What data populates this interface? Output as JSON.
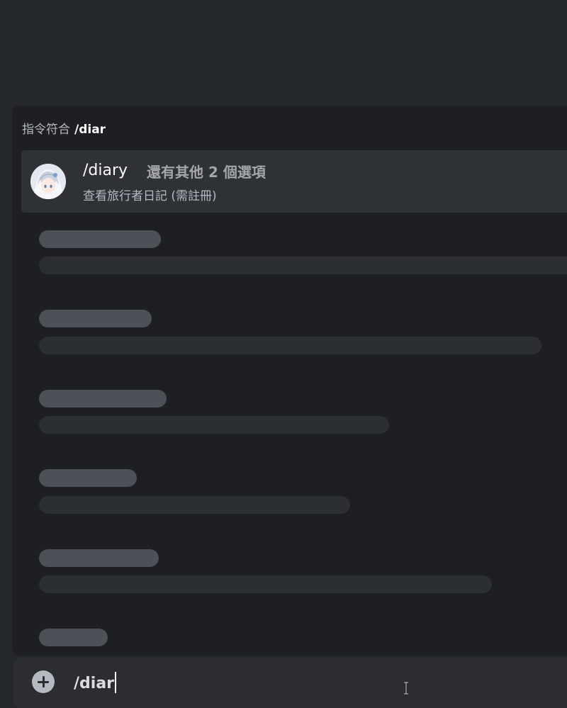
{
  "popup": {
    "header_label": "指令符合",
    "header_query": "/diar"
  },
  "command": {
    "name": "/diary",
    "more_options": "還有其他 2 個選項",
    "description": "查看旅行者日記 (需註冊)",
    "avatar_icon": "bot-avatar-icon"
  },
  "skeleton_rows": 6,
  "input": {
    "value": "/diar",
    "attach_icon": "plus-circle-icon"
  },
  "colors": {
    "background": "#24272b",
    "popup_bg": "#1d1f22",
    "selected_row": "#2e3136",
    "input_bg": "#2b2d31",
    "skeleton_title": "#4c5057",
    "skeleton_line": "#2b2e33"
  }
}
